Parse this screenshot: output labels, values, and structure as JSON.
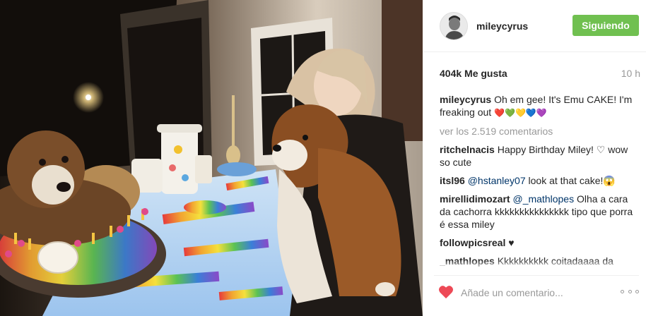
{
  "colors": {
    "follow_button": "#70c050",
    "like_heart": "#ed4956",
    "secondary_text": "#999999",
    "mention_link": "#003569"
  },
  "post": {
    "username": "mileycyrus",
    "follow_label": "Siguiendo",
    "likes": "404k Me gusta",
    "age": "10 h",
    "caption_user": "mileycyrus",
    "caption_text": "Oh em gee! It's Emu CAKE! I'm freaking out",
    "caption_emoji": "❤️💚💛💙💜",
    "view_all": "ver los 2.519 comentarios",
    "comments": [
      {
        "user": "ritchelnacis",
        "mention": "",
        "text": "Happy Birthday Miley! ♡ wow so cute"
      },
      {
        "user": "itsl96",
        "mention": "@hstanley07",
        "text": "look at that cake!😱"
      },
      {
        "user": "mirellidimozart",
        "mention": "@_mathlopes",
        "text": "Olha a cara da cachorra kkkkkkkkkkkkkkk tipo que porra é essa miley"
      },
      {
        "user": "followpicsreal",
        "mention": "",
        "text": "♥"
      },
      {
        "user": "_mathlopes",
        "mention": "",
        "text": "Kkkkkkkkkk coitadaaaa da cachorra @mirellidimozart"
      }
    ],
    "add_comment_placeholder": "Añade un comentario...",
    "icons": {
      "avatar": "avatar-image",
      "heart": "heart-icon",
      "more": "more-options-icon"
    }
  }
}
